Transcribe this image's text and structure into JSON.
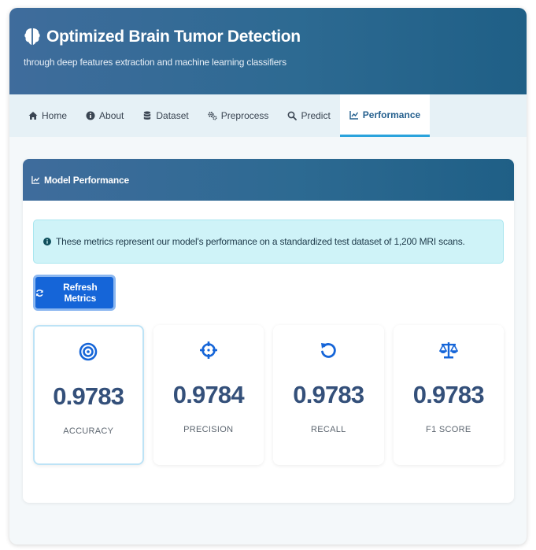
{
  "app": {
    "title": "Optimized Brain Tumor Detection",
    "subtitle": "through deep features extraction and machine learning classifiers"
  },
  "nav": {
    "tabs": [
      {
        "label": "Home",
        "icon": "home-icon"
      },
      {
        "label": "About",
        "icon": "info-icon"
      },
      {
        "label": "Dataset",
        "icon": "database-icon"
      },
      {
        "label": "Preprocess",
        "icon": "cogs-icon"
      },
      {
        "label": "Predict",
        "icon": "search-icon"
      },
      {
        "label": "Performance",
        "icon": "chart-line-icon",
        "active": true
      }
    ]
  },
  "panel": {
    "title": "Model Performance",
    "info_text": "These metrics represent our model's performance on a standardized test dataset of 1,200 MRI scans.",
    "refresh_label": "Refresh Metrics"
  },
  "metrics": [
    {
      "value": "0.9783",
      "label": "ACCURACY",
      "icon": "bullseye-icon"
    },
    {
      "value": "0.9784",
      "label": "PRECISION",
      "icon": "crosshairs-icon"
    },
    {
      "value": "0.9783",
      "label": "RECALL",
      "icon": "undo-icon"
    },
    {
      "value": "0.9783",
      "label": "F1 SCORE",
      "icon": "balance-scale-icon"
    }
  ],
  "colors": {
    "header": "#2d6a92",
    "accent": "#1565d8",
    "active_tab": "#25608e",
    "metric_value": "#34507a",
    "icon_blue": "#1565d8",
    "alert_bg": "#cff3f8"
  }
}
